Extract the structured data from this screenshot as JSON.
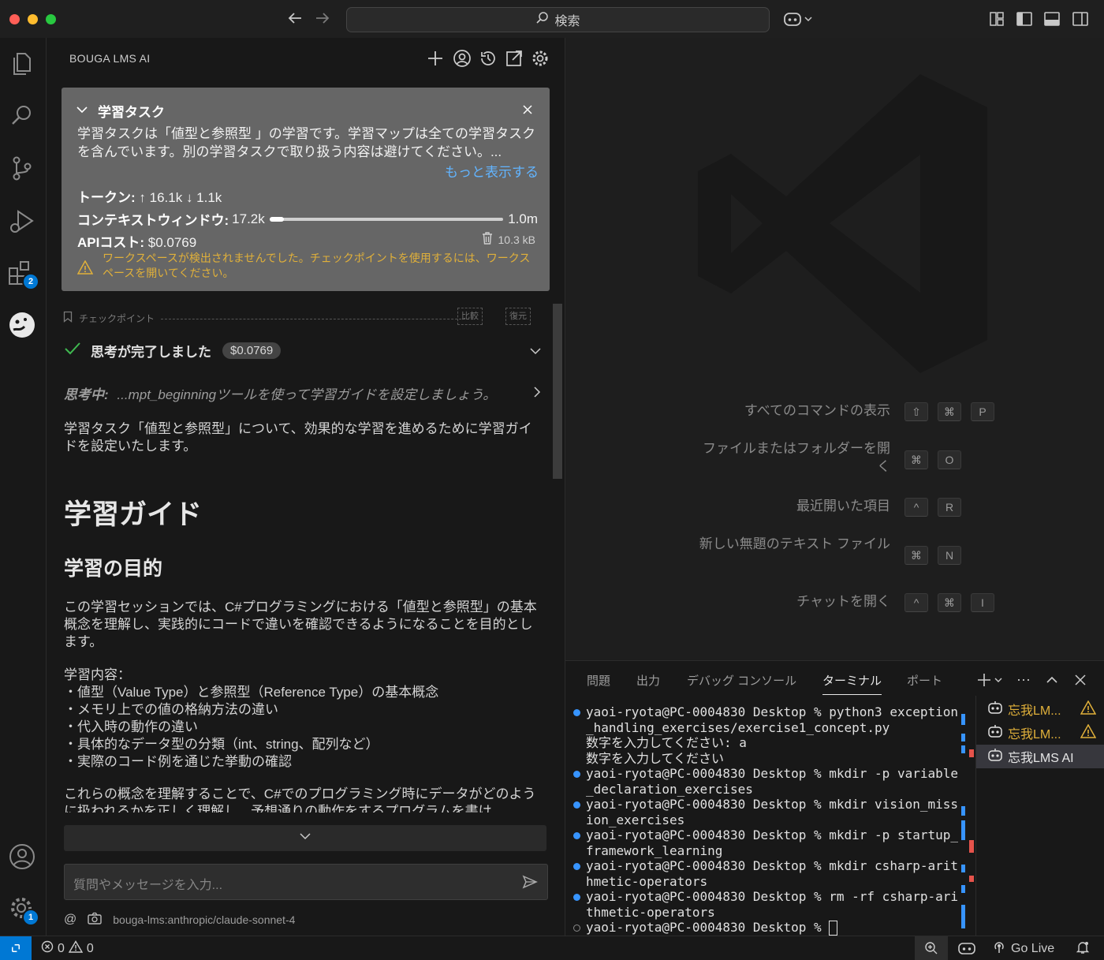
{
  "titlebar": {
    "search_text": "検索",
    "icons": [
      "back-arrow-icon",
      "forward-arrow-icon",
      "search-icon",
      "copilot-icon",
      "layout-customize-icon",
      "toggle-sidebar-icon",
      "toggle-panel-icon",
      "toggle-secondary-sidebar-icon"
    ]
  },
  "activity": {
    "icons": [
      "explorer-icon",
      "search-icon",
      "source-control-icon",
      "run-debug-icon",
      "extensions-icon",
      "bouga-lms-icon",
      "accounts-icon",
      "manage-gear-icon"
    ],
    "extensions_badge": "2",
    "manage_badge": "1"
  },
  "panel": {
    "title": "BOUGA LMS AI",
    "task": {
      "title": "学習タスク",
      "description": "学習タスクは「値型と参照型 」の学習です。学習マップは全ての学習タスクを含んでいます。別の学習タスクで取り扱う内容は避けてください。...",
      "more_link": "もっと表示する",
      "tokens_label": "トークン:",
      "tokens_up": "↑ 16.1k",
      "tokens_down": "↓ 1.1k",
      "context_label": "コンテキストウィンドウ:",
      "context_used": "17.2k",
      "context_max": "1.0m",
      "context_fraction": 0.017,
      "cost_label": "APIコスト:",
      "cost_value": "$0.0769",
      "size": "10.3 kB",
      "warning": "ワークスペースが検出されませんでした。チェックポイントを使用するには、ワークスペースを開いてください。"
    },
    "checkpoint": {
      "label": "チェックポイント",
      "compare": "比較",
      "restore": "復元"
    },
    "thinking_done": "思考が完了しました",
    "cost_pill": "$0.0769",
    "thinking_prefix": "思考中:",
    "thinking_text": "...mpt_beginningツールを使って学習ガイドを設定しましょう。",
    "intro": "学習タスク「値型と参照型」について、効果的な学習を進めるために学習ガイドを設定いたします。",
    "h1": "学習ガイド",
    "h2": "学習の目的",
    "purpose": "この学習セッションでは、C#プログラミングにおける「値型と参照型」の基本概念を理解し、実践的にコードで違いを確認できるようになることを目的とします。",
    "content_title": "学習内容：",
    "content_items": [
      "・値型（Value Type）と参照型（Reference Type）の基本概念",
      "・メモリ上での値の格納方法の違い",
      "・代入時の動作の違い",
      "・具体的なデータ型の分類（int、string、配列など）",
      "・実際のコード例を通じた挙動の確認"
    ],
    "closing": "これらの概念を理解することで、C#でのプログラミング時にデータがどのように扱われるかを正しく理解し、予想通りの動作をするプログラムを書け",
    "input_placeholder": "質問やメッセージを入力...",
    "model": "bouga-lms:anthropic/claude-sonnet-4"
  },
  "editor": {
    "commands": [
      {
        "label": "すべてのコマンドの表示",
        "keys": [
          "⇧",
          "⌘",
          "P"
        ]
      },
      {
        "label": "ファイルまたはフォルダーを開く",
        "keys": [
          "⌘",
          "O"
        ]
      },
      {
        "label": "最近開いた項目",
        "keys": [
          "^",
          "R"
        ]
      },
      {
        "label": "新しい無題のテキスト ファイル",
        "keys": [
          "⌘",
          "N"
        ]
      },
      {
        "label": "チャットを開く",
        "keys": [
          "^",
          "⌘",
          "I"
        ]
      }
    ]
  },
  "bottom_panel": {
    "tabs": [
      "問題",
      "出力",
      "デバッグ コンソール",
      "ターミナル",
      "ポート"
    ],
    "active_tab": "ターミナル",
    "terminal_lines": [
      {
        "dot": "blue",
        "text": "yaoi-ryota@PC-0004830 Desktop % python3 exception_handling_exercises/exercise1_concept.py"
      },
      {
        "dot": "none",
        "text": "数字を入力してください: a"
      },
      {
        "dot": "none",
        "text": "数字を入力してください"
      },
      {
        "dot": "blue",
        "text": "yaoi-ryota@PC-0004830 Desktop % mkdir -p variable_declaration_exercises"
      },
      {
        "dot": "blue",
        "text": "yaoi-ryota@PC-0004830 Desktop % mkdir vision_mission_exercises"
      },
      {
        "dot": "blue",
        "text": "yaoi-ryota@PC-0004830 Desktop % mkdir -p startup_framework_learning"
      },
      {
        "dot": "blue",
        "text": "yaoi-ryota@PC-0004830 Desktop % mkdir csharp-arithmetic-operators"
      },
      {
        "dot": "blue",
        "text": "yaoi-ryota@PC-0004830 Desktop % rm -rf csharp-arithmetic-operators"
      },
      {
        "dot": "hollow",
        "text": "yaoi-ryota@PC-0004830 Desktop % "
      }
    ],
    "sessions": [
      {
        "label": "忘我LM...",
        "warning": true
      },
      {
        "label": "忘我LM...",
        "warning": true
      },
      {
        "label": "忘我LMS AI",
        "warning": false
      }
    ]
  },
  "statusbar": {
    "errors": "0",
    "warnings": "0",
    "golive": "Go Live"
  }
}
